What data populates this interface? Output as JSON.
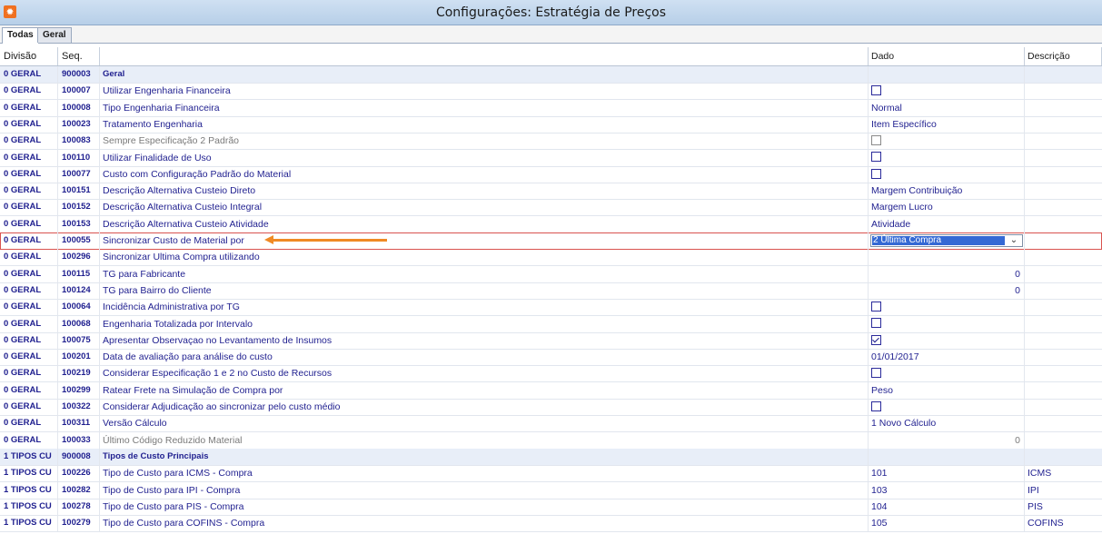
{
  "window": {
    "title": "Configurações: Estratégia de Preços",
    "app_icon": "bull-logo-icon"
  },
  "tabs": [
    {
      "label": "Todas",
      "active": true
    },
    {
      "label": "Geral",
      "active": false
    }
  ],
  "columns": {
    "divisao": "Divisão",
    "seq": "Seq.",
    "descricao": "",
    "dado": "Dado",
    "descr2": "Descrição"
  },
  "rows": [
    {
      "div": "0 GERAL",
      "seq": "900003",
      "desc": "Geral",
      "type": "group"
    },
    {
      "div": "0 GERAL",
      "seq": "100007",
      "desc": "Utilizar Engenharia Financeira",
      "dado_type": "checkbox",
      "checked": false
    },
    {
      "div": "0 GERAL",
      "seq": "100008",
      "desc": "Tipo Engenharia Financeira",
      "dado": "Normal"
    },
    {
      "div": "0 GERAL",
      "seq": "100023",
      "desc": "Tratamento Engenharia",
      "dado": "Item Específico"
    },
    {
      "div": "0 GERAL",
      "seq": "100083",
      "desc": "Sempre Especificação 2 Padrão",
      "dado_type": "checkbox",
      "checked": false,
      "disabled": true
    },
    {
      "div": "0 GERAL",
      "seq": "100110",
      "desc": "Utilizar Finalidade de Uso",
      "dado_type": "checkbox",
      "checked": false
    },
    {
      "div": "0 GERAL",
      "seq": "100077",
      "desc": "Custo com Configuração Padrão do Material",
      "dado_type": "checkbox",
      "checked": false
    },
    {
      "div": "0 GERAL",
      "seq": "100151",
      "desc": "Descrição Alternativa Custeio Direto",
      "dado": "Margem Contribuição"
    },
    {
      "div": "0 GERAL",
      "seq": "100152",
      "desc": "Descrição Alternativa Custeio Integral",
      "dado": "Margem Lucro"
    },
    {
      "div": "0 GERAL",
      "seq": "100153",
      "desc": "Descrição Alternativa Custeio Atividade",
      "dado": "Atividade"
    },
    {
      "div": "0 GERAL",
      "seq": "100055",
      "desc": "Sincronizar Custo de Material por",
      "dado_type": "dropdown",
      "dado": "2 Última Compra",
      "selected": true
    },
    {
      "div": "0 GERAL",
      "seq": "100296",
      "desc": "Sincronizar Ultima Compra utilizando"
    },
    {
      "div": "0 GERAL",
      "seq": "100115",
      "desc": "TG para Fabricante",
      "dado_num": "0"
    },
    {
      "div": "0 GERAL",
      "seq": "100124",
      "desc": "TG para Bairro do Cliente",
      "dado_num": "0"
    },
    {
      "div": "0 GERAL",
      "seq": "100064",
      "desc": "Incidência Administrativa por TG",
      "dado_type": "checkbox",
      "checked": false
    },
    {
      "div": "0 GERAL",
      "seq": "100068",
      "desc": "Engenharia Totalizada por Intervalo",
      "dado_type": "checkbox",
      "checked": false
    },
    {
      "div": "0 GERAL",
      "seq": "100075",
      "desc": "Apresentar Observaçao no Levantamento de Insumos",
      "dado_type": "checkbox",
      "checked": true
    },
    {
      "div": "0 GERAL",
      "seq": "100201",
      "desc": "Data de avaliação para análise do custo",
      "dado": "01/01/2017"
    },
    {
      "div": "0 GERAL",
      "seq": "100219",
      "desc": "Considerar Especificação 1 e 2 no Custo de Recursos",
      "dado_type": "checkbox",
      "checked": false
    },
    {
      "div": "0 GERAL",
      "seq": "100299",
      "desc": "Ratear Frete na Simulação de Compra por",
      "dado": "Peso"
    },
    {
      "div": "0 GERAL",
      "seq": "100322",
      "desc": "Considerar Adjudicação ao sincronizar pelo custo médio",
      "dado_type": "checkbox",
      "checked": false
    },
    {
      "div": "0 GERAL",
      "seq": "100311",
      "desc": "Versão Cálculo",
      "dado": "1 Novo Cálculo"
    },
    {
      "div": "0 GERAL",
      "seq": "100033",
      "desc": "Último Código Reduzido Material",
      "dado_num": "0",
      "disabled": true
    },
    {
      "div": "1 TIPOS CU",
      "seq": "900008",
      "desc": "Tipos de Custo Principais",
      "type": "group"
    },
    {
      "div": "1 TIPOS CU",
      "seq": "100226",
      "desc": "Tipo de Custo para ICMS - Compra",
      "dado": "101",
      "descr2": "ICMS"
    },
    {
      "div": "1 TIPOS CU",
      "seq": "100282",
      "desc": "Tipo de Custo para IPI - Compra",
      "dado": "103",
      "descr2": "IPI"
    },
    {
      "div": "1 TIPOS CU",
      "seq": "100278",
      "desc": "Tipo de Custo para PIS - Compra",
      "dado": "104",
      "descr2": "PIS"
    },
    {
      "div": "1 TIPOS CU",
      "seq": "100279",
      "desc": "Tipo de Custo para COFINS - Compra",
      "dado": "105",
      "descr2": "COFINS"
    }
  ],
  "colors": {
    "text": "#1f1f8f",
    "group_bg": "#e8eef8",
    "highlight_outline": "#d9534f",
    "arrow": "#f08a24",
    "dropdown_selected": "#3569d4"
  }
}
